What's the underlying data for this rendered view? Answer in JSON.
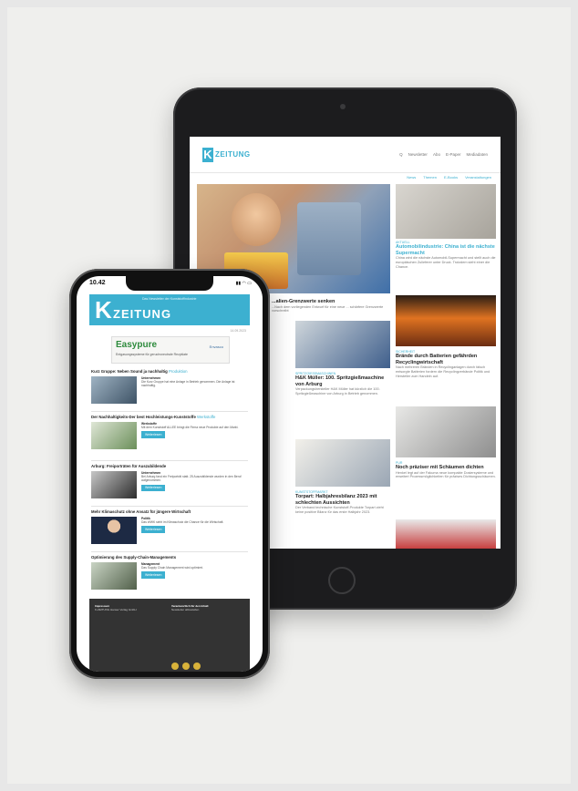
{
  "tablet": {
    "logo_k": "K",
    "logo_text": "ZEITUNG",
    "utility": [
      "Q",
      "Newsletter",
      "Abo",
      "E-Paper",
      "Mediadaten"
    ],
    "nav": [
      "News",
      "Themen",
      "E-Books",
      "Veranstaltungen"
    ],
    "side1": {
      "tag": "Aktuell",
      "headline": "Automobilindustrie: China ist die nächste Supermacht",
      "teaser": "China wird die nächste Automobil-Supermacht und stellt auch die europäischen Zulieferer unter Druck. Trotzdem sieht einer die Chance."
    },
    "side2": {
      "tag": "Sicherheit",
      "headline": "Brände durch Batterien gefährden Recyclingwirtschaft",
      "teaser": "Nach mehreren Bränden in Recyclinganlagen durch falsch entsorgte Batterien fordern die Recyclingverbände Politik und Hersteller zum Handeln auf."
    },
    "side3": {
      "tag": "Pur",
      "headline": "Noch präziser mit Schäumen dichten",
      "teaser": "Henkel legt auf der Fakuma neue kompakte Dosiersysteme und erweitert Prozessmöglichkeiten für präzises Dichtungsschäumen."
    },
    "main_title": "...alien-Grenzwerte senken",
    "main_teaser": "...Nach dem vorliegenden Entwurf für eine neue ... schärfere Grenzwerte vorschreibt",
    "mid1": {
      "tag": "Spritzgießmaschinen",
      "headline": "H&K Müller: 100. Spritzgießmaschine von Arburg",
      "teaser": "Verpackungshersteller H&K Müller hat kürzlich die 100. Spritzgießmaschine von Arburg in Betrieb genommen."
    },
    "mid2": {
      "tag": "Kunststoffmarkt",
      "headline": "Torpart: Halbjahresbilanz 2023 mit schlechten Aussichten",
      "teaser": "Der Verband technische Kunststoff-Produkte Torpart zieht keine positive Bilanz für das erste Halbjahr 2023."
    }
  },
  "phone": {
    "time": "10.42",
    "status": "▮▮ ◠ ▭",
    "banner_k": "K",
    "banner_text": "ZEITUNG",
    "banner_sub": "Das Newsletter der Kunststoffindustrie",
    "date": "14.09.2023",
    "ad": {
      "brand": "Easypure",
      "text": "Entgasungssysteme für geruchsneutrale Rezyklate",
      "logo": "Envasco"
    },
    "articles": [
      {
        "title": "Kurz Gruppe: Neben Sound ja nachhaltig",
        "section": "Produktion",
        "kicker": "Unternehmen",
        "text": "Die Kurz Gruppe hat eine Anlage in Betrieb genommen. Die Anlage ist nachhaltig.",
        "button": "Weiterlesen"
      },
      {
        "title": "Der Nachhaltigkeits-Der best Hochleistungs-Kunststoffe",
        "section": "Werkstoffe",
        "kicker": "Werkstoffe",
        "text": "Mit dem Kunststoff ALLEE bringt die Firma neue Produkte auf den Markt.",
        "button": "Weiterlesen"
      },
      {
        "title": "Arburg: Freiporträten für Auszubildende",
        "section": "",
        "kicker": "Unternehmen",
        "text": "Bei Arburg fand ein Freiporträt statt. 25 Auszubildende wurden in den Beruf aufgenommen.",
        "button": "Weiterlesen"
      },
      {
        "title": "Mehr Klimaschutz ohne Ansatz für jüngere Wirtschaft",
        "section": "",
        "kicker": "Politik",
        "text": "Das WWK sieht im Klimaschutz die Chance für die Wirtschaft.",
        "button": "Weiterlesen"
      },
      {
        "title": "Optimierung des Supply-Chain-Managements",
        "section": "",
        "kicker": "Management",
        "text": "Das Supply Chain Management wird optimiert.",
        "button": "Weiterlesen"
      }
    ],
    "footer": {
      "col1_title": "Impressum",
      "col1_text": "K-ZEITUNG Hanser Verlag GmbH",
      "col2_title": "Verantwortlich für den Inhalt",
      "col2_text": "Newsletter abbestellen"
    }
  }
}
